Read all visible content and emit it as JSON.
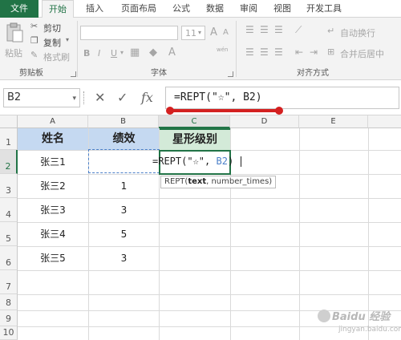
{
  "tabs": [
    "文件",
    "开始",
    "插入",
    "页面布局",
    "公式",
    "数据",
    "审阅",
    "视图",
    "开发工具"
  ],
  "clipboard": {
    "paste": "粘贴",
    "cut": "剪切",
    "copy": "复制",
    "format_painter": "格式刷",
    "label": "剪贴板"
  },
  "font": {
    "size": "11",
    "bold": "B",
    "italic": "I",
    "underline": "U",
    "label": "字体",
    "grow": "A",
    "shrink": "A",
    "wen": "wén"
  },
  "alignment": {
    "wrap_text": "自动换行",
    "merge_center": "合并后居中",
    "label": "对齐方式"
  },
  "formula_bar": {
    "name_box": "B2",
    "cancel": "✕",
    "enter": "✓",
    "fx": "fx",
    "formula": "=REPT(\"☆\", B2)"
  },
  "columns": [
    "A",
    "B",
    "C",
    "D",
    "E"
  ],
  "rows": [
    "1",
    "2",
    "3",
    "4",
    "5",
    "6",
    "7",
    "8",
    "9",
    "10"
  ],
  "table": {
    "headers": [
      "姓名",
      "绩效",
      "星形级别"
    ],
    "names": [
      "张三1",
      "张三2",
      "张三3",
      "张三4",
      "张三5"
    ],
    "scores": [
      "",
      "1",
      "3",
      "5",
      "3"
    ]
  },
  "editing": {
    "prefix": "=REPT(\"☆\",",
    "ref": "B2",
    "suffix": ")",
    "tooltip_fn": "REPT(",
    "tooltip_arg1": "text",
    "tooltip_rest": ", number_times)"
  },
  "watermark": {
    "line1": "Baidu 经验",
    "line2": "jingyan.baidu.com"
  }
}
